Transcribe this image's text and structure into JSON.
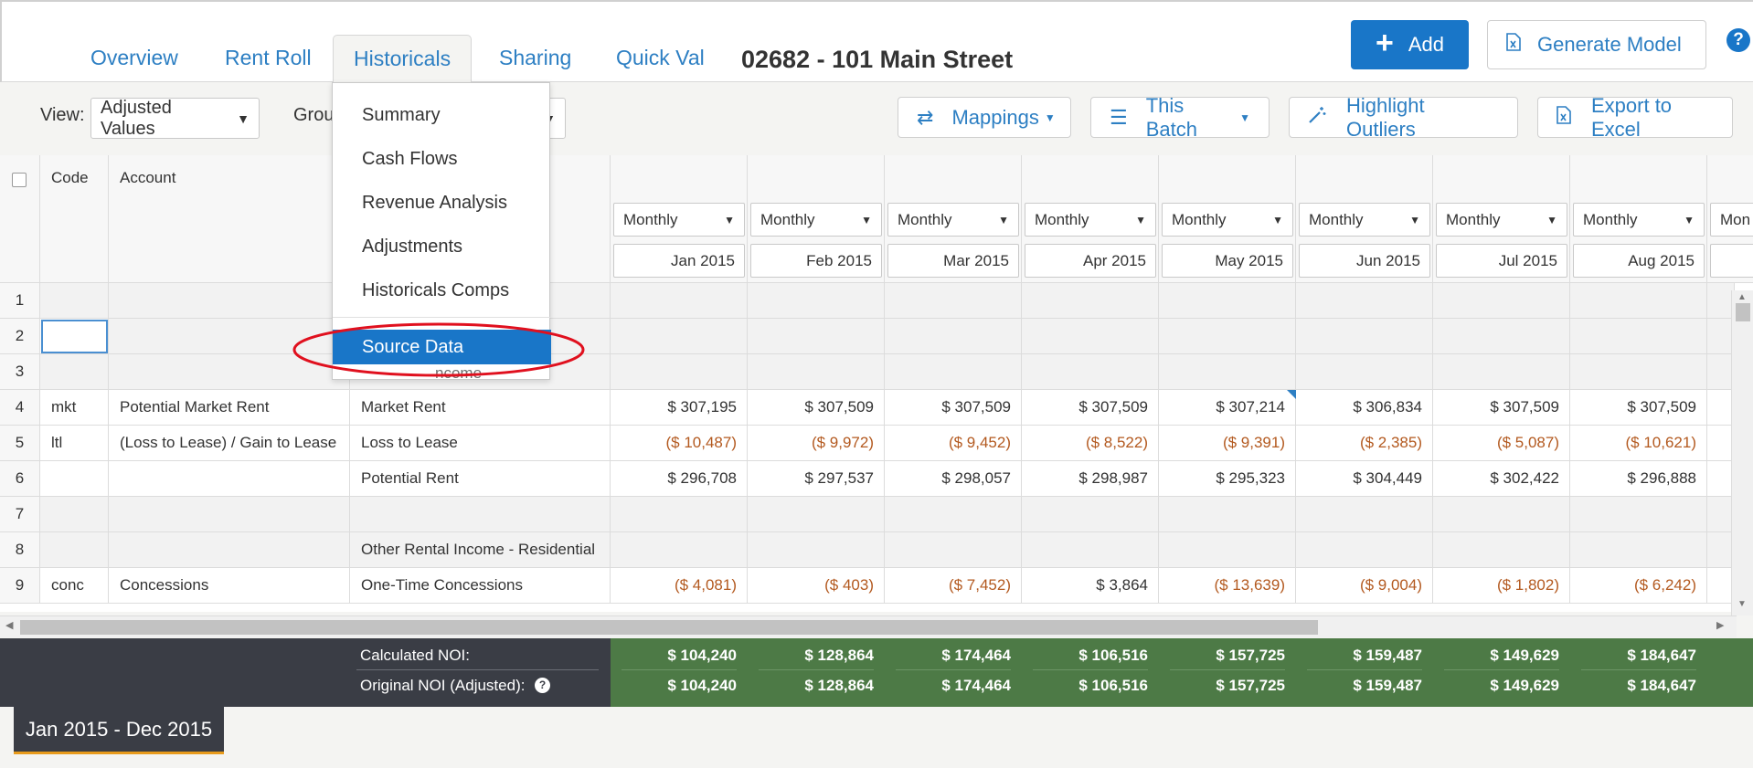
{
  "nav": {
    "tabs": [
      "Overview",
      "Rent Roll",
      "Historicals",
      "Sharing",
      "Quick Val"
    ],
    "active_tab": "Historicals",
    "page_title": "02682 - 101 Main Street",
    "add_label": "Add",
    "generate_label": "Generate Model",
    "help": "?"
  },
  "toolbar": {
    "view_label": "View:",
    "view_value": "Adjusted Values",
    "group_label": "Grou",
    "mappings_label": "Mappings",
    "batch_label": "This Batch",
    "outliers_label": "Highlight Outliers",
    "export_label": "Export to Excel"
  },
  "menu": {
    "items": [
      "Summary",
      "Cash Flows",
      "Revenue Analysis",
      "Adjustments",
      "Historicals Comps"
    ],
    "selected": "Source Data",
    "obscured_text": "ncome - Residential"
  },
  "grid": {
    "columns": [
      "Code",
      "Account"
    ],
    "period_type": "Monthly",
    "months": [
      "Jan 2015",
      "Feb 2015",
      "Mar 2015",
      "Apr 2015",
      "May 2015",
      "Jun 2015",
      "Jul 2015",
      "Aug 2015"
    ],
    "next_month_partial": "Mon",
    "rows": [
      {
        "n": "1",
        "code": "",
        "account": "",
        "label": "",
        "values": [
          "",
          "",
          "",
          "",
          "",
          "",
          "",
          ""
        ],
        "shade": true
      },
      {
        "n": "2",
        "code": "",
        "account": "",
        "label": "",
        "values": [
          "",
          "",
          "",
          "",
          "",
          "",
          "",
          ""
        ],
        "shade": true
      },
      {
        "n": "3",
        "code": "",
        "account": "",
        "label": "",
        "values": [
          "",
          "",
          "",
          "",
          "",
          "",
          "",
          ""
        ],
        "shade": true
      },
      {
        "n": "4",
        "code": "mkt",
        "account": "Potential Market Rent",
        "label": "Market Rent",
        "values": [
          "$ 307,195",
          "$ 307,509",
          "$ 307,509",
          "$ 307,509",
          "$ 307,214",
          "$ 306,834",
          "$ 307,509",
          "$ 307,509"
        ],
        "shade": false
      },
      {
        "n": "5",
        "code": "ltl",
        "account": "(Loss to Lease) / Gain to Lease",
        "label": "Loss to Lease",
        "values": [
          "($ 10,487)",
          "($ 9,972)",
          "($ 9,452)",
          "($ 8,522)",
          "($ 9,391)",
          "($ 2,385)",
          "($ 5,087)",
          "($ 10,621)"
        ],
        "shade": false
      },
      {
        "n": "6",
        "code": "",
        "account": "",
        "label": "Potential Rent",
        "values": [
          "$ 296,708",
          "$ 297,537",
          "$ 298,057",
          "$ 298,987",
          "$ 295,323",
          "$ 304,449",
          "$ 302,422",
          "$ 296,888"
        ],
        "shade": false
      },
      {
        "n": "7",
        "code": "",
        "account": "",
        "label": "",
        "values": [
          "",
          "",
          "",
          "",
          "",
          "",
          "",
          ""
        ],
        "shade": true
      },
      {
        "n": "8",
        "code": "",
        "account": "",
        "label": "Other Rental Income - Residential",
        "values": [
          "",
          "",
          "",
          "",
          "",
          "",
          "",
          ""
        ],
        "shade": true
      },
      {
        "n": "9",
        "code": "conc",
        "account": "Concessions",
        "label": "One-Time Concessions",
        "values": [
          "($ 4,081)",
          "($ 403)",
          "($ 7,452)",
          "$ 3,864",
          "($ 13,639)",
          "($ 9,004)",
          "($ 1,802)",
          "($ 6,242)"
        ],
        "shade": false
      }
    ]
  },
  "footer": {
    "calc_label": "Calculated NOI:",
    "orig_label": "Original NOI (Adjusted):",
    "calc_values": [
      "$ 104,240",
      "$ 128,864",
      "$ 174,464",
      "$ 106,516",
      "$ 157,725",
      "$ 159,487",
      "$ 149,629",
      "$ 184,647"
    ],
    "orig_values": [
      "$ 104,240",
      "$ 128,864",
      "$ 174,464",
      "$ 106,516",
      "$ 157,725",
      "$ 159,487",
      "$ 149,629",
      "$ 184,647"
    ]
  },
  "date_range": "Jan 2015 - Dec 2015",
  "colors": {
    "accent": "#1976c8",
    "negative": "#b3591f",
    "noi_green": "#4d7a46",
    "highlight_ring": "#e0101e"
  }
}
